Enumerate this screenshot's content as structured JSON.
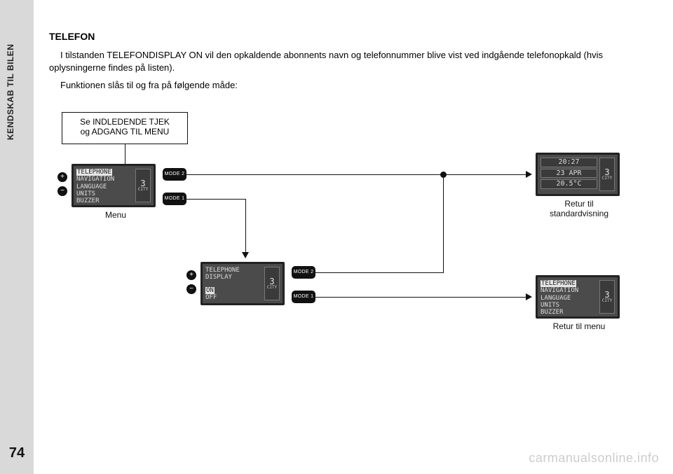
{
  "page": {
    "side_label": "KENDSKAB TIL BILEN",
    "page_number": "74"
  },
  "heading": "TELEFON",
  "paragraph1": "I tilstanden TELEFONDISPLAY ON vil den opkaldende abonnents navn og telefonnummer blive vist ved indgående telefonopkald (hvis oplysningerne findes på listen).",
  "paragraph2": "Funktionen slås til og fra på følgende måde:",
  "intro_box": {
    "line1": "Se INDLEDENDE TJEK",
    "line2": "og ADGANG TIL MENU"
  },
  "screens": {
    "menu": {
      "items": [
        "TELEPHONE",
        "NAVIGATION",
        "LANGUAGE",
        "UNITS",
        "BUZZER"
      ],
      "highlight_index": 0,
      "gear": "3",
      "city_label": "CITY",
      "caption": "Menu"
    },
    "detail": {
      "title1": "TELEPHONE",
      "title2": "DISPLAY",
      "options": [
        "ON",
        "OFF"
      ],
      "highlight_index": 0,
      "gear": "3",
      "city_label": "CITY"
    },
    "return_menu": {
      "items": [
        "TELEPHONE",
        "NAVIGATION",
        "LANGUAGE",
        "UNITS",
        "BUZZER"
      ],
      "highlight_index": 0,
      "gear": "3",
      "city_label": "CITY",
      "caption": "Retur til menu"
    },
    "standard": {
      "rows": [
        "20:27",
        "23 APR",
        "20.5°C"
      ],
      "gear": "3",
      "city_label": "CITY",
      "caption_line1": "Retur til",
      "caption_line2": "standardvisning"
    }
  },
  "buttons": {
    "plus": "+",
    "minus": "−",
    "mode1": "MODE 1",
    "mode2": "MODE 2"
  },
  "watermark": "carmanualsonline.info"
}
